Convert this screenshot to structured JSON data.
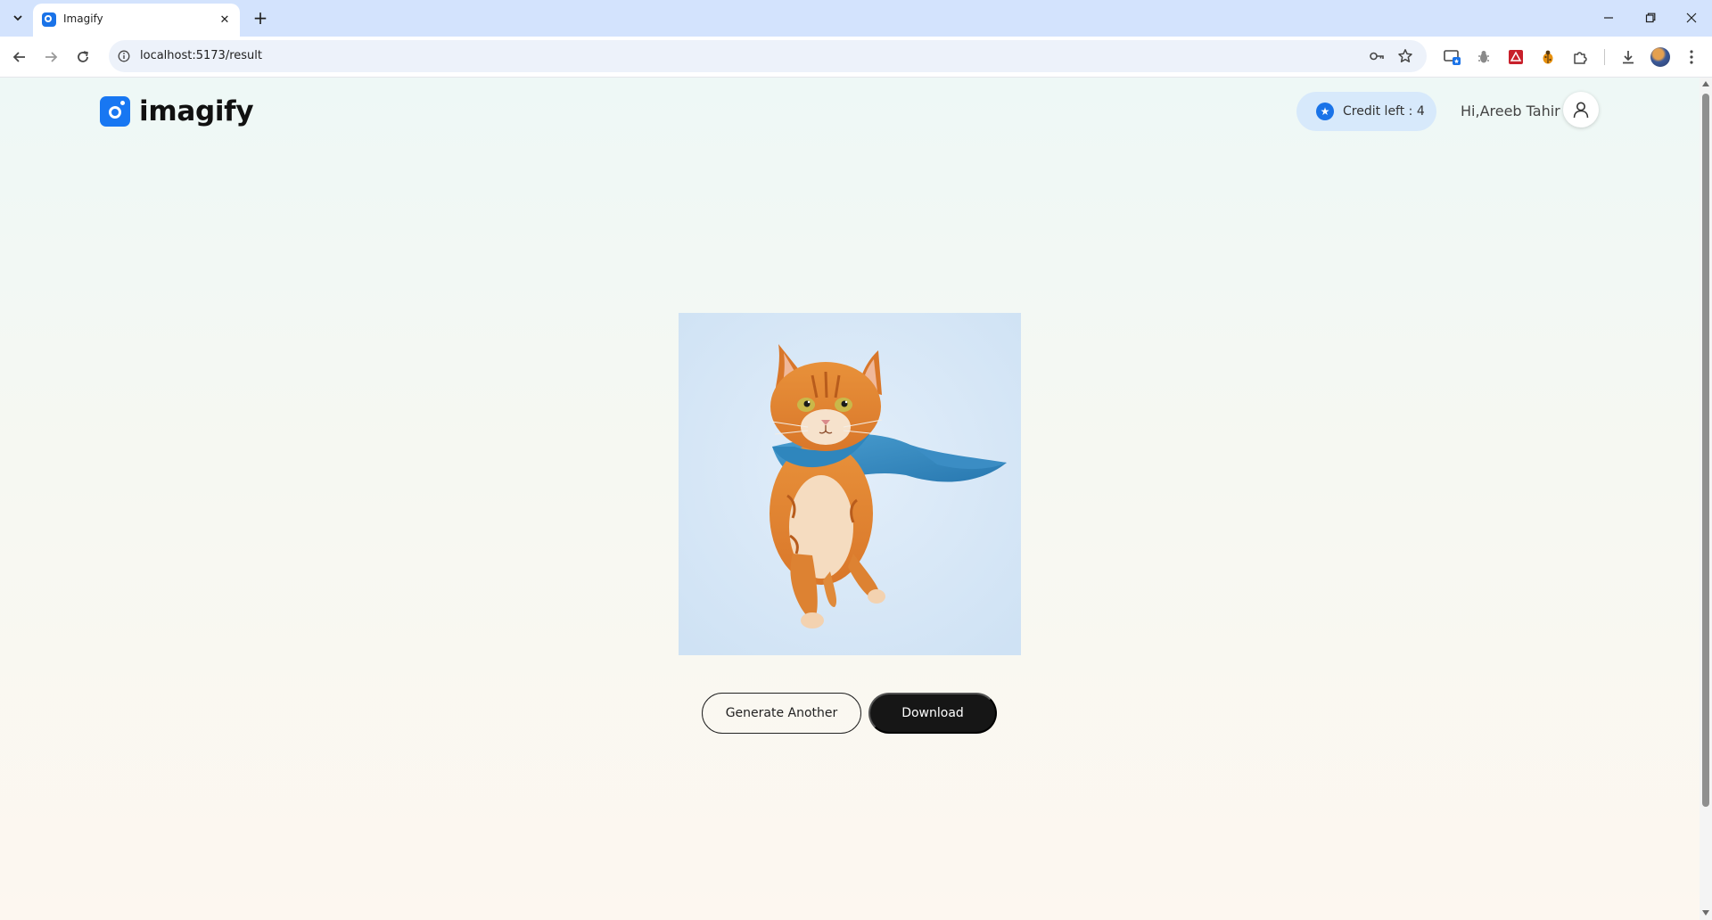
{
  "browser": {
    "tab_title": "Imagify",
    "url": "localhost:5173/result",
    "new_tab_symbol": "+",
    "close_symbol": "✕",
    "icons": [
      "tab-search-icon",
      "back-icon",
      "forward-icon",
      "reload-icon",
      "site-info-icon",
      "password-key-icon",
      "bookmark-star-icon",
      "cast-icon",
      "ext-bug-icon",
      "ext-red-icon",
      "ext-ladybug-icon",
      "extensions-puzzle-icon",
      "downloads-icon",
      "profile-avatar-icon",
      "kebab-menu-icon",
      "minimize-icon",
      "restore-icon",
      "close-window-icon"
    ]
  },
  "app": {
    "logo_text": "imagify",
    "credit_label": "Credit left : 4",
    "greeting": "Hi,Areeb Tahir",
    "accent_color": "#1877f2",
    "result_image_description": "orange kitten wearing a blue cape on light blue background",
    "buttons": {
      "generate_another": "Generate Another",
      "download": "Download"
    }
  }
}
